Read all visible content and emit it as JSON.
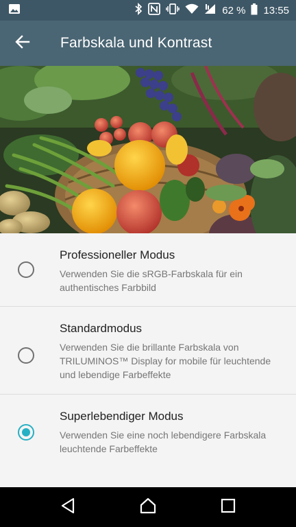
{
  "status_bar": {
    "battery_percent": "62 %",
    "time": "13:55",
    "icons": [
      "image-notification-icon",
      "bluetooth-icon",
      "nfc-icon",
      "vibrate-icon",
      "wifi-icon",
      "cell-signal-icon",
      "battery-icon"
    ]
  },
  "app_bar": {
    "title": "Farbskala und Kontrast",
    "back_icon": "arrow-left-icon"
  },
  "hero_image": {
    "description_icon": "vegetables-photo"
  },
  "options": [
    {
      "title": "Professioneller Modus",
      "summary": "Verwenden Sie die sRGB-Farbskala für ein authentisches Farbbild",
      "selected": false
    },
    {
      "title": "Standardmodus",
      "summary": "Verwenden Sie die brillante Farbskala von TRILUMINOS™ Display for mobile für leuchtende und lebendige Farbeffekte",
      "selected": false
    },
    {
      "title": "Superlebendiger Modus",
      "summary": "Verwenden Sie eine noch lebendigere Farbskala leuchtende Farbeffekte",
      "selected": true
    }
  ],
  "colors": {
    "status_bar": "#3e5766",
    "app_bar": "#4a6573",
    "accent": "#26b0c4",
    "background": "#f4f4f4"
  },
  "nav_bar": {
    "icons": [
      "back-triangle-icon",
      "home-icon",
      "recents-icon"
    ]
  }
}
